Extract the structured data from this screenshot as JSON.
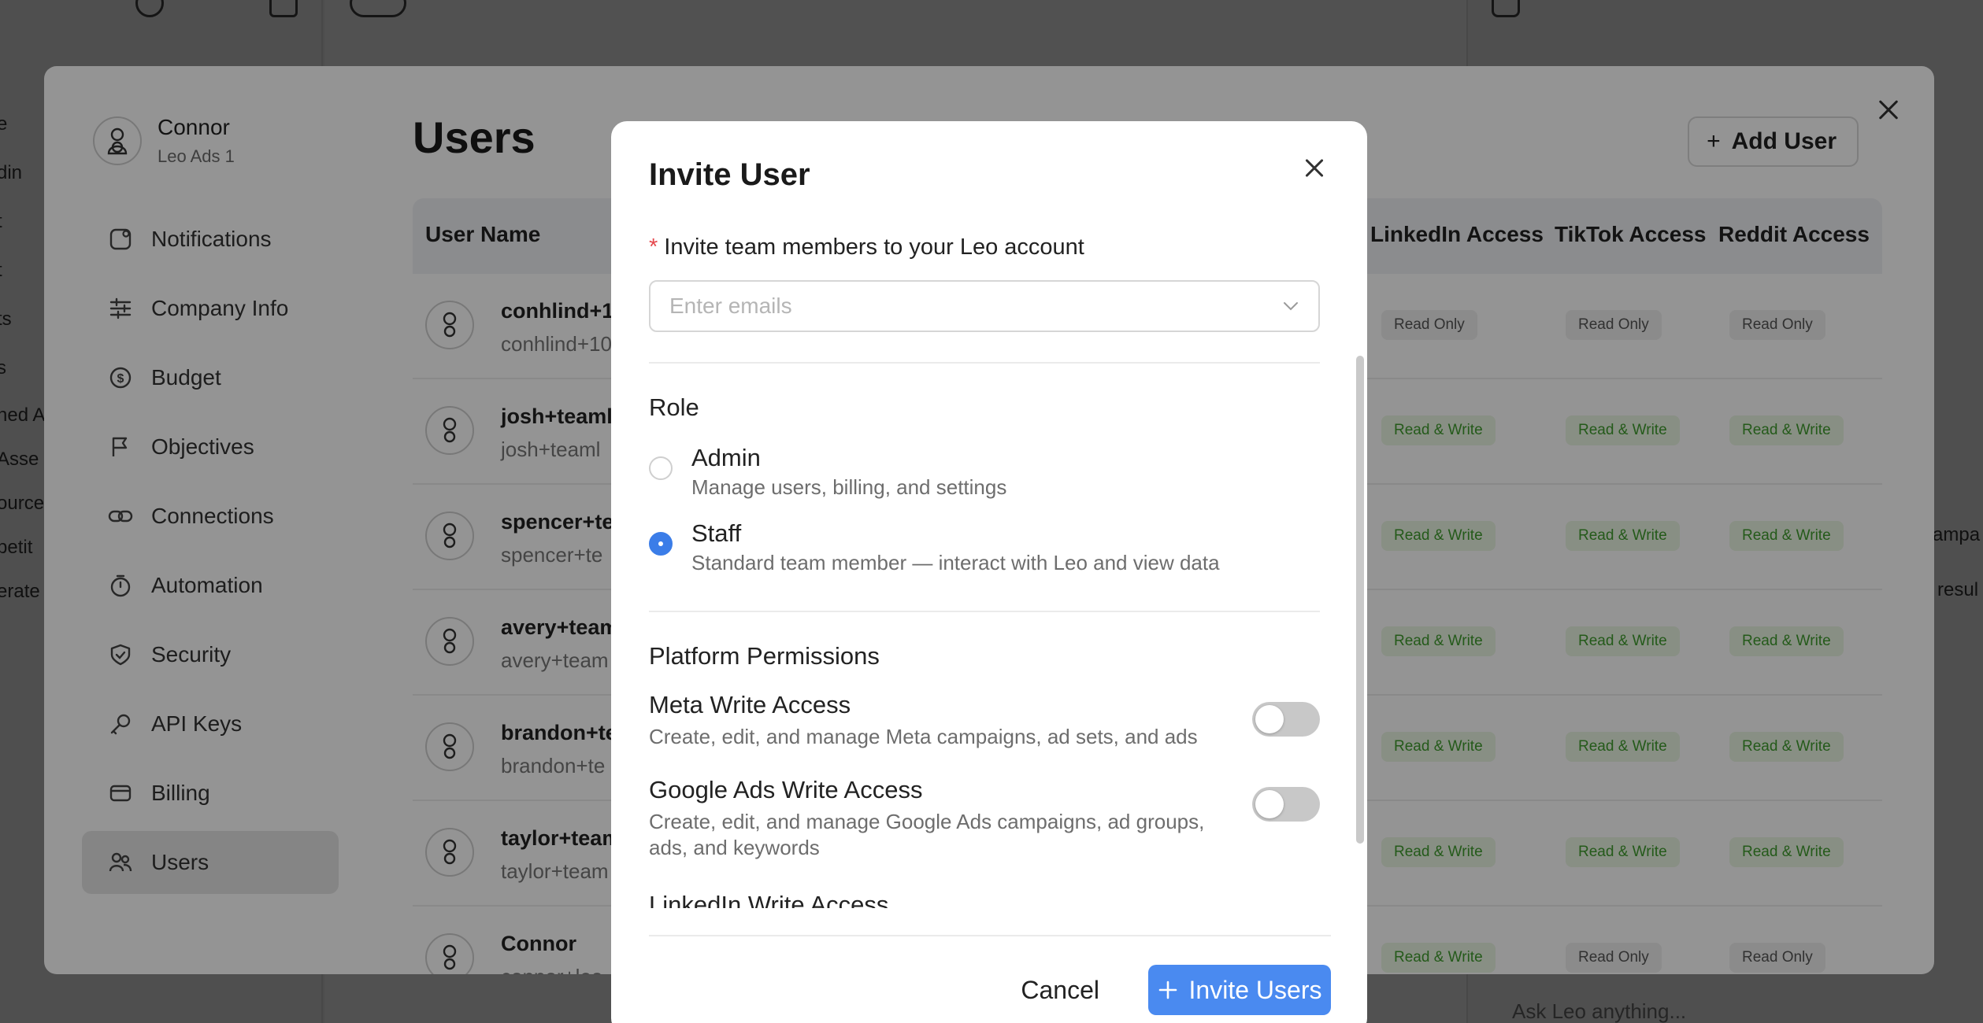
{
  "background_app": {
    "sidebar_fragments": [
      "e",
      "din",
      "t",
      "t",
      "ts",
      "s",
      "hed A",
      "Asse",
      "ource",
      "petit",
      "erate"
    ],
    "right_fragments": [
      "ampa",
      "resul"
    ],
    "bottom_input_placeholder": "Ask Leo anything..."
  },
  "settings": {
    "account": {
      "name": "Connor",
      "org": "Leo Ads 1"
    },
    "nav": [
      {
        "label": "Notifications",
        "icon": "bell-icon"
      },
      {
        "label": "Company Info",
        "icon": "sliders-icon"
      },
      {
        "label": "Budget",
        "icon": "dollar-icon"
      },
      {
        "label": "Objectives",
        "icon": "flag-icon"
      },
      {
        "label": "Connections",
        "icon": "link-icon"
      },
      {
        "label": "Automation",
        "icon": "timer-icon"
      },
      {
        "label": "Security",
        "icon": "shield-icon"
      },
      {
        "label": "API Keys",
        "icon": "key-icon"
      },
      {
        "label": "Billing",
        "icon": "card-icon"
      },
      {
        "label": "Users",
        "icon": "users-icon",
        "active": true
      }
    ],
    "page_title": "Users",
    "add_user_label": "Add User",
    "table": {
      "columns": [
        "User Name",
        "LinkedIn Access",
        "TikTok Access",
        "Reddit Access"
      ],
      "rows": [
        {
          "name": "conhlind+1(",
          "email": "conhlind+10",
          "linkedin": "Read Only",
          "tiktok": "Read Only",
          "reddit": "Read Only"
        },
        {
          "name": "josh+teaml",
          "email": "josh+teaml",
          "linkedin": "Read & Write",
          "tiktok": "Read & Write",
          "reddit": "Read & Write"
        },
        {
          "name": "spencer+te",
          "email": "spencer+te",
          "linkedin": "Read & Write",
          "tiktok": "Read & Write",
          "reddit": "Read & Write"
        },
        {
          "name": "avery+team",
          "email": "avery+team",
          "linkedin": "Read & Write",
          "tiktok": "Read & Write",
          "reddit": "Read & Write"
        },
        {
          "name": "brandon+te",
          "email": "brandon+te",
          "linkedin": "Read & Write",
          "tiktok": "Read & Write",
          "reddit": "Read & Write"
        },
        {
          "name": "taylor+team",
          "email": "taylor+team",
          "linkedin": "Read & Write",
          "tiktok": "Read & Write",
          "reddit": "Read & Write"
        },
        {
          "name": "Connor",
          "email": "connor+leo",
          "linkedin": "Read & Write",
          "tiktok": "Read Only",
          "reddit": "Read Only"
        }
      ]
    }
  },
  "modal": {
    "title": "Invite User",
    "invite_label": "Invite team members to your Leo account",
    "email_placeholder": "Enter emails",
    "role_title": "Role",
    "roles": [
      {
        "title": "Admin",
        "desc": "Manage users, billing, and settings",
        "checked": false
      },
      {
        "title": "Staff",
        "desc": "Standard team member — interact with Leo and view data",
        "checked": true
      }
    ],
    "permissions_title": "Platform Permissions",
    "permissions": [
      {
        "title": "Meta Write Access",
        "desc": "Create, edit, and manage Meta campaigns, ad sets, and ads",
        "enabled": false
      },
      {
        "title": "Google Ads Write Access",
        "desc": "Create, edit, and manage Google Ads campaigns, ad groups, ads, and keywords",
        "enabled": false
      },
      {
        "title": "LinkedIn Write Access",
        "desc": "",
        "enabled": false
      }
    ],
    "cancel_label": "Cancel",
    "submit_label": "Invite Users"
  },
  "colors": {
    "accent": "#4a8af0",
    "radio_checked": "#3b7de8",
    "required": "#e5484d",
    "read_write": "#3f9b2d"
  }
}
